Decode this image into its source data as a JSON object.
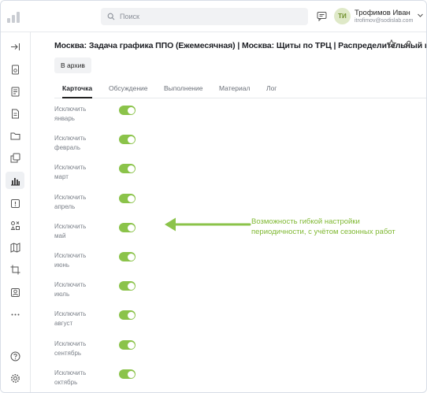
{
  "header": {
    "search_placeholder": "Поиск",
    "user": {
      "initials": "ТИ",
      "name": "Трофимов Иван",
      "email": "itrofimov@sodislab.com"
    }
  },
  "sidebar": {
    "items": [
      {
        "icon": "arrow-right-to-bar-icon"
      },
      {
        "icon": "device-icon"
      },
      {
        "icon": "document-edit-icon"
      },
      {
        "icon": "document-icon"
      },
      {
        "icon": "folder-icon"
      },
      {
        "icon": "copy-icon"
      },
      {
        "icon": "chart-icon",
        "active": true
      },
      {
        "icon": "alert-icon"
      },
      {
        "icon": "shapes-icon"
      },
      {
        "icon": "map-icon"
      },
      {
        "icon": "crop-icon"
      },
      {
        "icon": "id-card-icon"
      },
      {
        "icon": "more-icon"
      },
      {
        "icon": "help-icon"
      },
      {
        "icon": "settings-icon"
      }
    ]
  },
  "main": {
    "title": "Москва: Задача графика ППО (Ежемесячная) | Москва: Щиты по ТРЦ | Распределительный щит",
    "archive_button": "В архив",
    "tabs": [
      {
        "label": "Карточка",
        "active": true
      },
      {
        "label": "Обсуждение"
      },
      {
        "label": "Выполнение"
      },
      {
        "label": "Материал"
      },
      {
        "label": "Лог"
      }
    ],
    "exclusions": [
      {
        "line1": "Исключить",
        "line2": "январь",
        "on": true
      },
      {
        "line1": "Исключить",
        "line2": "февраль",
        "on": true
      },
      {
        "line1": "Исключить",
        "line2": "март",
        "on": true
      },
      {
        "line1": "Исключить",
        "line2": "апрель",
        "on": true
      },
      {
        "line1": "Исключить",
        "line2": "май",
        "on": true
      },
      {
        "line1": "Исключить",
        "line2": "июнь",
        "on": true
      },
      {
        "line1": "Исключить",
        "line2": "июль",
        "on": true
      },
      {
        "line1": "Исключить",
        "line2": "август",
        "on": true
      },
      {
        "line1": "Исключить",
        "line2": "сентябрь",
        "on": true
      },
      {
        "line1": "Исключить",
        "line2": "октябрь",
        "on": true
      }
    ]
  },
  "annotation": {
    "line1": "Возможность гибкой настройки",
    "line2": "периодичности, с учётом сезонных работ",
    "color": "#7fb832"
  },
  "colors": {
    "toggle_on": "#8bc34a",
    "avatar_bg": "#dfe9c8"
  }
}
